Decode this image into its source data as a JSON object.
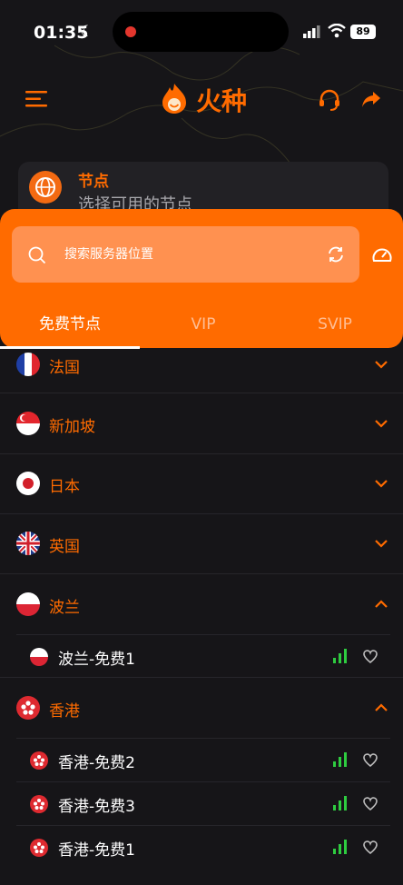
{
  "status_bar": {
    "time": "01:35",
    "battery": "89"
  },
  "header": {
    "title": "火种"
  },
  "node_card": {
    "label": "节点",
    "subtitle": "选择可用的节点"
  },
  "search": {
    "placeholder": "搜索服务器位置"
  },
  "tabs": [
    {
      "label": "免费节点",
      "active": true
    },
    {
      "label": "VIP",
      "active": false
    },
    {
      "label": "SVIP",
      "active": false
    }
  ],
  "countries": [
    {
      "name": "法国",
      "flag": "france",
      "expanded": false
    },
    {
      "name": "新加坡",
      "flag": "singapore",
      "expanded": false
    },
    {
      "name": "日本",
      "flag": "japan",
      "expanded": false
    },
    {
      "name": "英国",
      "flag": "uk",
      "expanded": false
    },
    {
      "name": "波兰",
      "flag": "poland",
      "expanded": true,
      "servers": [
        {
          "name": "波兰-免费1"
        }
      ]
    },
    {
      "name": "香港",
      "flag": "hongkong",
      "expanded": true,
      "servers": [
        {
          "name": "香港-免费2"
        },
        {
          "name": "香港-免费3"
        },
        {
          "name": "香港-免费1"
        }
      ]
    }
  ],
  "colors": {
    "accent": "#ff6b00",
    "background": "#161518",
    "signal": "#2ecc40"
  }
}
